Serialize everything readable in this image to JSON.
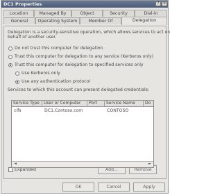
{
  "window": {
    "title": "DC1 Properties",
    "help_glyph": "?",
    "close_glyph": "×"
  },
  "tabs_row1": [
    "Location",
    "Managed By",
    "Object",
    "Security",
    "Dial-in"
  ],
  "tabs_row2": [
    "General",
    "Operating System",
    "Member Of",
    "Delegation"
  ],
  "description": [
    "Delegation is a security-sensitive operation, which allows services to act on",
    "behalf of another user."
  ],
  "options": {
    "no_delegation": "Do not trust this computer for delegation",
    "any_service": "Trust this computer for delegation to any service (Kerberos only)",
    "specified_services": "Trust this computer for delegation to specified services only",
    "kerberos_only": "Use Kerberos only",
    "any_protocol": "Use any authentication protocol"
  },
  "services_label": "Services to which this account can present delegated credentials:",
  "table": {
    "columns": [
      "Service Type",
      "User or Computer",
      "Port",
      "Service Name",
      "Do"
    ],
    "rows": [
      [
        "cifs",
        "DC1.Contoso.com",
        "",
        "CONTOSO",
        ""
      ]
    ]
  },
  "expanded_label": "Expanded",
  "buttons": {
    "add": "Add...",
    "remove": "Remove",
    "ok": "OK",
    "cancel": "Cancel",
    "apply": "Apply"
  },
  "colors": {
    "title_bar": "#4a5a78",
    "dialog_bg": "#e6e5e1"
  }
}
